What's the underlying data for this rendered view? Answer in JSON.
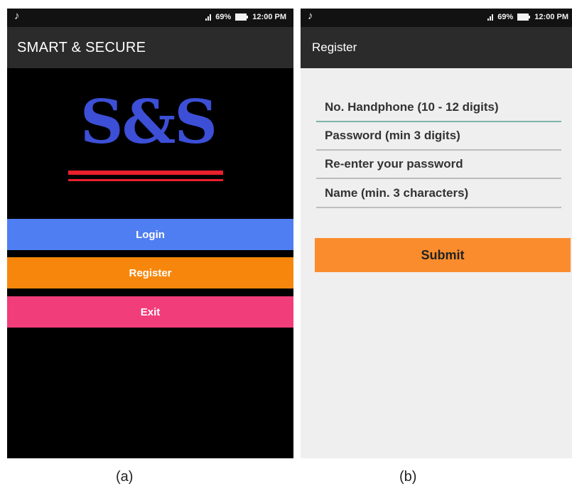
{
  "screen_a": {
    "status": {
      "time": "12:00 PM",
      "battery": "69%"
    },
    "title": "SMART & SECURE",
    "logo_text": "S&S",
    "buttons": {
      "login": "Login",
      "register": "Register",
      "exit": "Exit"
    },
    "colors": {
      "login": "#4f7ef2",
      "register": "#f7870c",
      "exit": "#f23d7b",
      "logo": "#3c4fd6",
      "logo_underline": "#e8202c"
    }
  },
  "screen_b": {
    "status": {
      "time": "12:00 PM",
      "battery": "69%"
    },
    "title": "Register",
    "fields": {
      "phone": "No. Handphone (10 - 12 digits)",
      "password": "Password (min 3 digits)",
      "reenter": "Re-enter your password",
      "name": "Name (min. 3 characters)"
    },
    "submit_label": "Submit",
    "colors": {
      "submit": "#fb8c2d",
      "active_underline": "#7fb3a6"
    }
  },
  "captions": {
    "a": "(a)",
    "b": "(b)"
  }
}
